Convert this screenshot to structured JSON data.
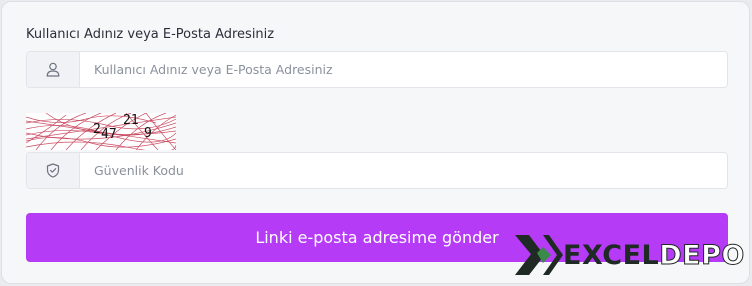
{
  "form": {
    "username_label": "Kullanıcı Adınız veya E-Posta Adresiniz",
    "username_placeholder": "Kullanıcı Adınız veya E-Posta Adresiniz",
    "username_value": "",
    "username_icon": "user-icon",
    "captcha_digits": [
      "2",
      "47",
      "21",
      "9"
    ],
    "security_placeholder": "Güvenlik Kodu",
    "security_value": "",
    "security_icon": "shield-check-icon",
    "submit_label": "Linki e-posta adresime gönder"
  },
  "watermark": {
    "part1": "EXCEL",
    "part2": "DEPO"
  },
  "colors": {
    "accent": "#b53bf6",
    "captcha_noise": "#c0304a",
    "watermark_dark": "#1f2a24"
  }
}
